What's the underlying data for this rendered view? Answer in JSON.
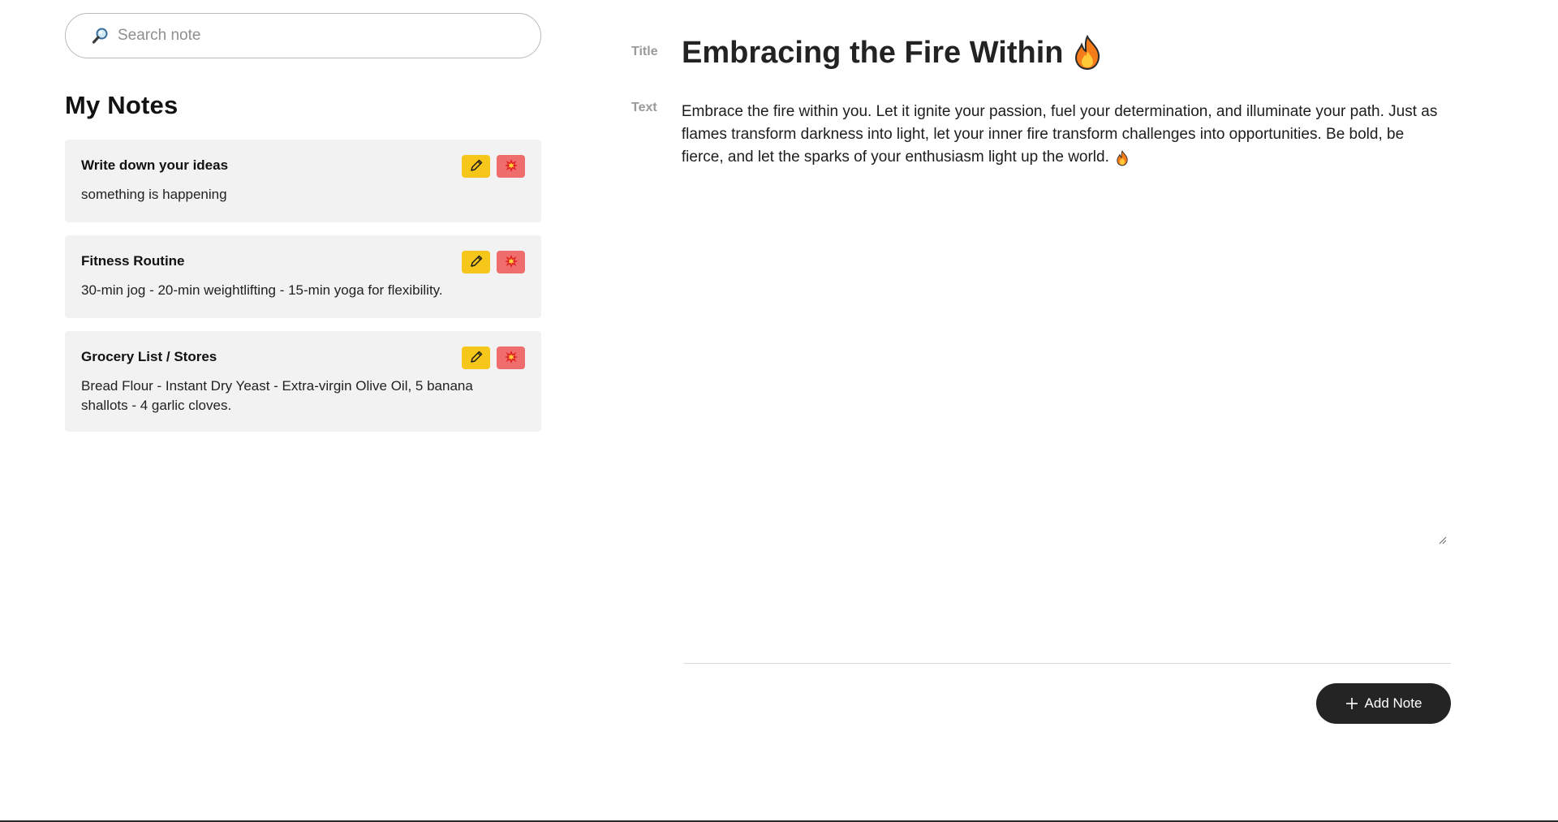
{
  "search": {
    "placeholder": "Search note",
    "value": ""
  },
  "notes_heading": "My Notes",
  "notes": [
    {
      "title": "Write down your ideas",
      "body": "something is happening"
    },
    {
      "title": "Fitness Routine",
      "body": "30-min jog - 20-min weightlifting - 15-min yoga for flexibility."
    },
    {
      "title": "Grocery List / Stores",
      "body": "Bread Flour - Instant Dry Yeast - Extra-virgin Olive Oil, 5 banana shallots - 4 garlic cloves."
    }
  ],
  "editor": {
    "title_label": "Title",
    "title_value": "Embracing the Fire Within",
    "text_label": "Text",
    "text_value": "Embrace the fire within you. Let it ignite your passion, fuel your determination, and illuminate your path. Just as flames transform darkness into light, let your inner fire transform challenges into opportunities. Be bold, be fierce, and let the sparks of your enthusiasm light up the world."
  },
  "add_button_label": "Add Note",
  "icons": {
    "search": "magnifier-icon",
    "edit": "pencil-icon",
    "delete": "collision-icon",
    "fire": "fire-icon",
    "add": "plus-icon"
  },
  "colors": {
    "edit_button": "#f7c61b",
    "delete_button": "#f06d6d",
    "card_background": "#f2f2f2",
    "primary_button": "#242424"
  }
}
